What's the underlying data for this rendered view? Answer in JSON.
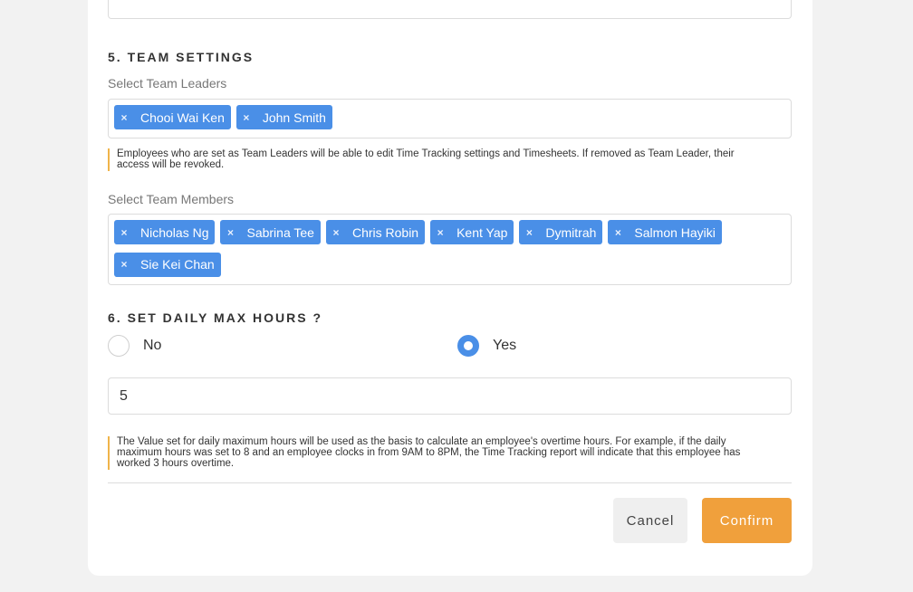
{
  "sections": {
    "team_settings_title": "5. TEAM SETTINGS",
    "daily_max_title": "6. SET DAILY MAX HOURS ?"
  },
  "team_leaders": {
    "label": "Select Team Leaders",
    "tags": [
      "Chooi Wai Ken",
      "John Smith"
    ],
    "note_line1": "Employees who are set as Team Leaders will be able to edit Time Tracking settings and Timesheets. If removed as Team Leader, their",
    "note_line2": "access will be revoked."
  },
  "team_members": {
    "label": "Select Team Members",
    "tags": [
      "Nicholas Ng",
      "Sabrina Tee",
      "Chris Robin",
      "Kent Yap",
      "Dymitrah",
      "Salmon Hayiki",
      "Sie Kei Chan"
    ]
  },
  "daily_max": {
    "option_no": "No",
    "option_yes": "Yes",
    "selected": "Yes",
    "value": "5",
    "note_line1": "The Value set for daily maximum hours will be used as the basis to calculate an employee's overtime hours. For example, if the daily",
    "note_line2": "maximum hours was set to 8 and an employee clocks in from 9AM to 8PM, the Time Tracking report will indicate that this employee has",
    "note_line3": "worked 3 hours overtime."
  },
  "buttons": {
    "cancel": "Cancel",
    "confirm": "Confirm"
  },
  "tag_remove_glyph": "×",
  "colors": {
    "tag_blue": "#4a8fe7",
    "confirm_orange": "#f0a03c",
    "note_accent": "#f0b44a",
    "background": "#f2f2f2"
  }
}
